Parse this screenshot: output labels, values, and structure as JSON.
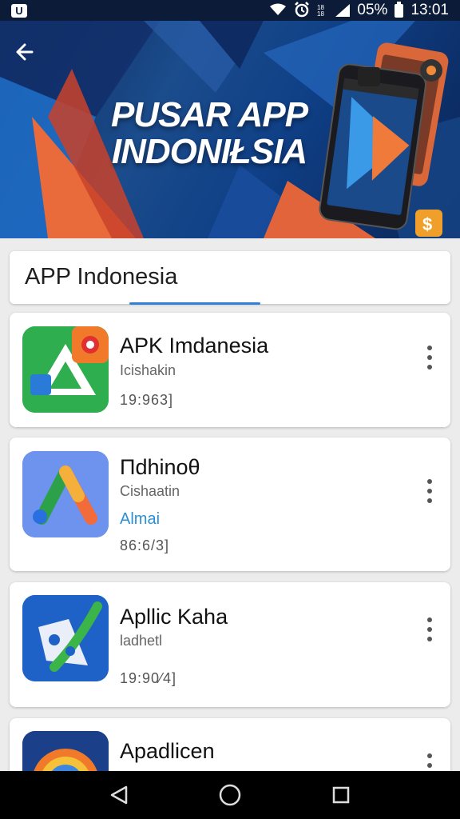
{
  "status_bar": {
    "battery_text": "05%",
    "time": "13:01",
    "left_icon": "app-notification-icon",
    "icons": [
      "wifi-icon",
      "alarm-icon",
      "data-icon",
      "signal-icon",
      "battery-icon"
    ]
  },
  "banner": {
    "title": "PUSAR APP INDONIŁSIA"
  },
  "search": {
    "label": "APP Indonesia"
  },
  "apps": [
    {
      "name": "APK Imdanesia",
      "subtitle": "Icishakin",
      "tag": "",
      "meta": "19:963]",
      "icon": "triangle-logo-icon"
    },
    {
      "name": "Πdhinoθ",
      "subtitle": "Cishaatin",
      "tag": "Almai",
      "meta": "86:6/3]",
      "icon": "arrow-logo-icon"
    },
    {
      "name": "Apllic Kaha",
      "subtitle": "ladhetl",
      "tag": "",
      "meta": "19:90⁄4]",
      "icon": "brush-logo-icon"
    },
    {
      "name": "Apadlicen",
      "subtitle": "",
      "tag": "",
      "meta": "",
      "icon": "rainbow-logo-icon"
    }
  ],
  "nav": {
    "back": "back-triangle-icon",
    "home": "home-circle-icon",
    "recents": "recents-square-icon"
  },
  "colors": {
    "accent": "#2f80d6",
    "status_bar": "#0c1c38",
    "card_bg": "#ffffff",
    "page_bg": "#ececec"
  }
}
